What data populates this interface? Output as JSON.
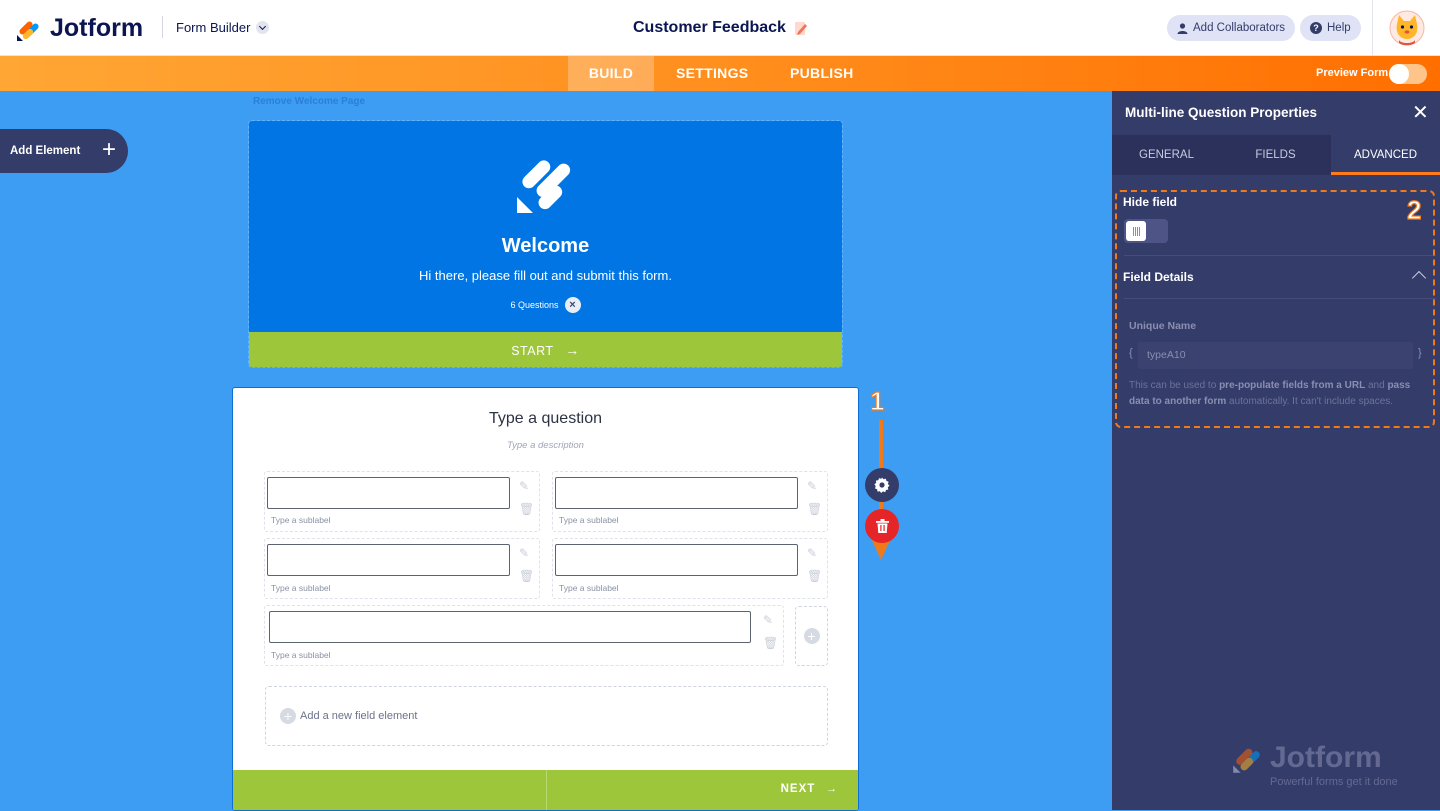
{
  "header": {
    "brand": "Jotform",
    "mode": "Form Builder",
    "form_title": "Customer Feedback",
    "add_collaborators": "Add Collaborators",
    "help": "Help"
  },
  "nav": {
    "tabs": [
      "BUILD",
      "SETTINGS",
      "PUBLISH"
    ],
    "active_tab": "BUILD",
    "preview_label": "Preview Form"
  },
  "canvas": {
    "remove_welcome": "Remove Welcome Page",
    "add_element": "Add Element",
    "welcome": {
      "title": "Welcome",
      "subtitle": "Hi there, please fill out and submit this form.",
      "count": "6 Questions",
      "start": "START"
    },
    "question": {
      "title": "Type a question",
      "description": "Type a description",
      "sublabel": "Type a sublabel",
      "add_field": "Add a new field element",
      "next": "NEXT"
    }
  },
  "panel": {
    "title": "Multi-line Question Properties",
    "tabs": [
      "GENERAL",
      "FIELDS",
      "ADVANCED"
    ],
    "active_tab": "ADVANCED",
    "hide_field_label": "Hide field",
    "field_details_label": "Field Details",
    "unique_name_label": "Unique Name",
    "unique_name_value": "typeA10",
    "help_1": "This can be used to ",
    "help_b1": "pre-populate fields from a URL",
    "help_2": " and ",
    "help_b2": "pass data to another form",
    "help_3": " automatically. It can't include spaces.",
    "watermark_brand": "Jotform",
    "watermark_tagline": "Powerful forms get it done"
  },
  "annotations": {
    "step1": "1",
    "step2": "2",
    "accent": "#f07a1a"
  },
  "colors": {
    "canvas": "#3d9df3",
    "navy": "#0a1551",
    "panel": "#343c6a",
    "green": "#9ec63b",
    "welcome_blue": "#0075e3"
  }
}
